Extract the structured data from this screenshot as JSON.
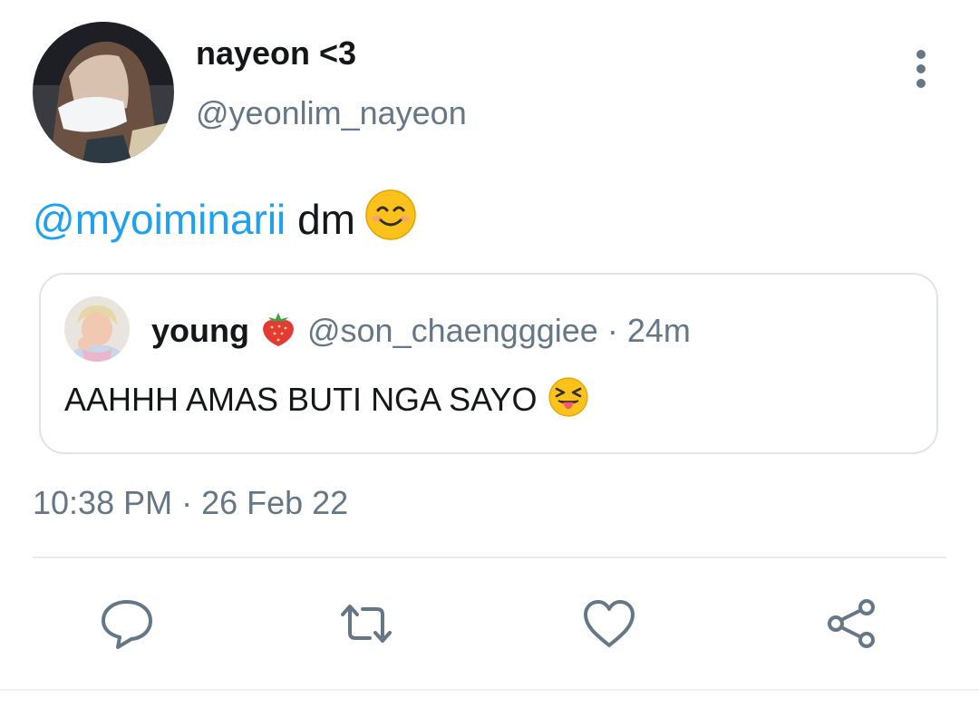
{
  "author": {
    "display_name": "nayeon <3",
    "handle": "@yeonlim_nayeon",
    "avatar_icon": "profile-photo-masked-woman"
  },
  "tweet": {
    "mention": "@myoiminarii",
    "text": "dm",
    "emoji": "smiling-face-icon"
  },
  "quoted_tweet": {
    "display_name": "young",
    "name_emoji": "strawberry-icon",
    "handle": "@son_chaengggiee",
    "separator": "·",
    "time": "24m",
    "text": "AAHHH AMAS BUTI NGA SAYO",
    "text_emoji": "squinting-tongue-face-icon"
  },
  "timestamp": "10:38 PM · 26 Feb 22",
  "actions": [
    {
      "name": "reply",
      "icon": "speech-bubble-icon"
    },
    {
      "name": "retweet",
      "icon": "retweet-arrows-icon"
    },
    {
      "name": "like",
      "icon": "heart-icon"
    },
    {
      "name": "share",
      "icon": "share-icon"
    }
  ],
  "colors": {
    "mention": "#1da1f2",
    "secondary_text": "#657786",
    "primary_text": "#14171a",
    "icon": "#657786",
    "border": "#dfe4e8"
  }
}
